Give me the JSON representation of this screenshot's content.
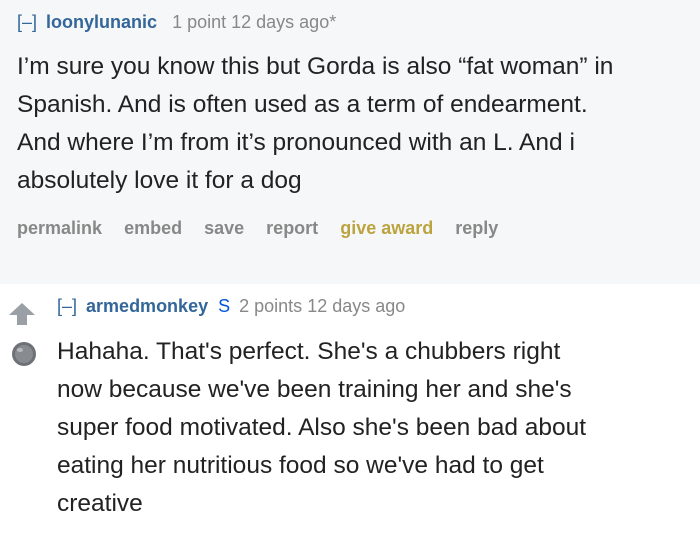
{
  "comments": [
    {
      "toggle": "[–]",
      "author": "loonylunanic",
      "score": "1 point",
      "age": "12 days ago*",
      "body_lines": [
        "I’m sure you know this but Gorda is also “fat woman” in",
        "Spanish. And is often used as a term of endearment.",
        "And where I’m from it’s pronounced with an L. And i",
        "absolutely love it for a dog"
      ],
      "actions": {
        "permalink": "permalink",
        "embed": "embed",
        "save": "save",
        "report": "report",
        "give_award": "give award",
        "reply": "reply"
      }
    },
    {
      "toggle": "[–]",
      "author": "armedmonkey",
      "submitter_badge": "S",
      "score": "2 points",
      "age": "12 days ago",
      "body_lines": [
        "Hahaha. That's perfect. She's a chubbers right",
        "now because we've been training her and she's",
        "super food motivated. Also she's been bad about",
        "eating her nutritious food so we've had to get",
        "creative"
      ]
    }
  ],
  "icons": {
    "upvote": "upvote-arrow-icon",
    "award": "award-medal-icon"
  },
  "colors": {
    "author": "#336699",
    "submitter": "#0055df",
    "award_action": "#bba43f",
    "meta": "#888888",
    "comment_bg": "#f6f7f8"
  }
}
